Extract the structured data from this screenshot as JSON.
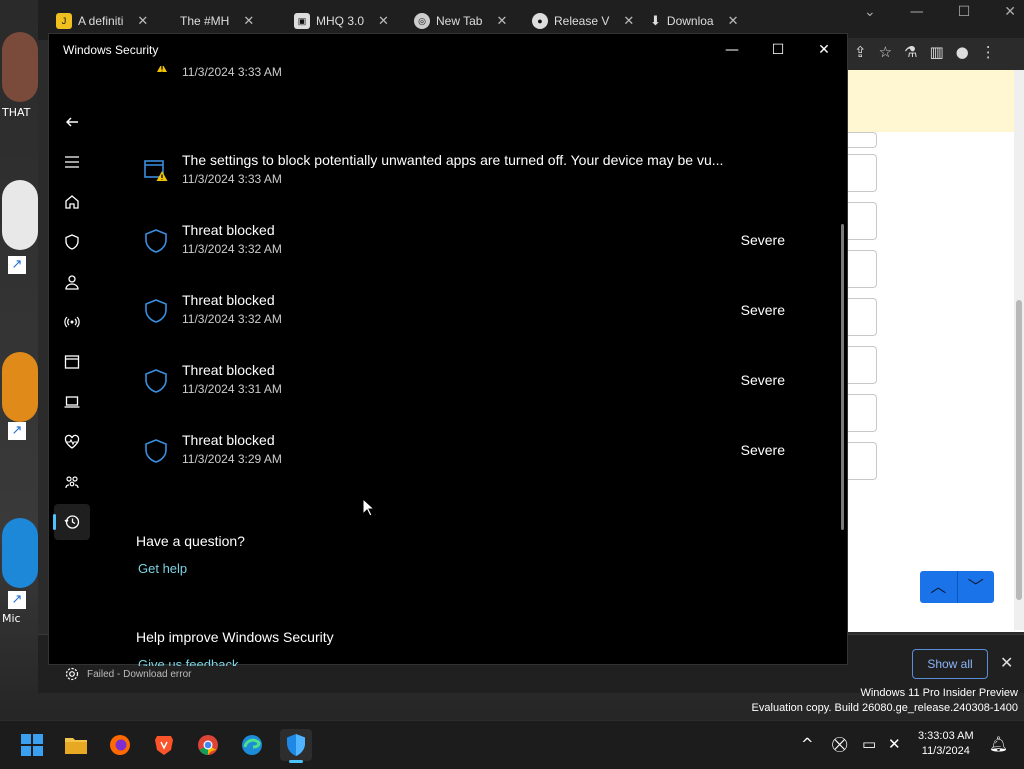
{
  "browser": {
    "tabs": [
      {
        "label": "A definiti",
        "icon": "joe-site-icon"
      },
      {
        "label": "The #MH",
        "icon": "generic-tab-icon"
      },
      {
        "label": "MHQ 3.0",
        "icon": "mhq-icon"
      },
      {
        "label": "New Tab",
        "icon": "chrome-icon"
      },
      {
        "label": "Release V",
        "icon": "github-icon"
      },
      {
        "label": "Downloa",
        "icon": "download-icon"
      }
    ],
    "download_status": "Failed - Download error",
    "show_all_label": "Show all"
  },
  "desktop": {
    "labels": [
      "THAT",
      "Mic"
    ]
  },
  "watermark": {
    "line1": "Windows 11 Pro Insider Preview",
    "line2": "Evaluation copy. Build 26080.ge_release.240308-1400"
  },
  "window": {
    "title": "Windows Security",
    "nav_items": [
      "back",
      "menu",
      "home",
      "virus-protection",
      "account-protection",
      "firewall",
      "app-browser-control",
      "device-security",
      "device-performance",
      "family-options",
      "protection-history",
      "settings"
    ]
  },
  "history": {
    "items": [
      {
        "title": "",
        "date": "11/3/2024 3:33 AM",
        "type": "warning",
        "severity": ""
      },
      {
        "title": "The settings to block potentially unwanted apps are turned off. Your device may be vu...",
        "date": "11/3/2024 3:33 AM",
        "type": "warning",
        "severity": ""
      },
      {
        "title": "Threat blocked",
        "date": "11/3/2024 3:32 AM",
        "type": "shield",
        "severity": "Severe"
      },
      {
        "title": "Threat blocked",
        "date": "11/3/2024 3:32 AM",
        "type": "shield",
        "severity": "Severe"
      },
      {
        "title": "Threat blocked",
        "date": "11/3/2024 3:31 AM",
        "type": "shield",
        "severity": "Severe"
      },
      {
        "title": "Threat blocked",
        "date": "11/3/2024 3:29 AM",
        "type": "shield",
        "severity": "Severe"
      }
    ]
  },
  "help": {
    "question_heading": "Have a question?",
    "get_help_link": "Get help",
    "improve_heading": "Help improve Windows Security",
    "feedback_link": "Give us feedback"
  },
  "taskbar": {
    "apps": [
      "start",
      "file-explorer",
      "firefox",
      "brave",
      "chrome",
      "edge",
      "windows-security"
    ],
    "time": "3:33:03 AM",
    "date": "11/3/2024"
  },
  "colors": {
    "accent": "#4cc2ff",
    "link": "#7ad2e4",
    "shield": "#3a8fe0",
    "warning": "#f5c400"
  }
}
